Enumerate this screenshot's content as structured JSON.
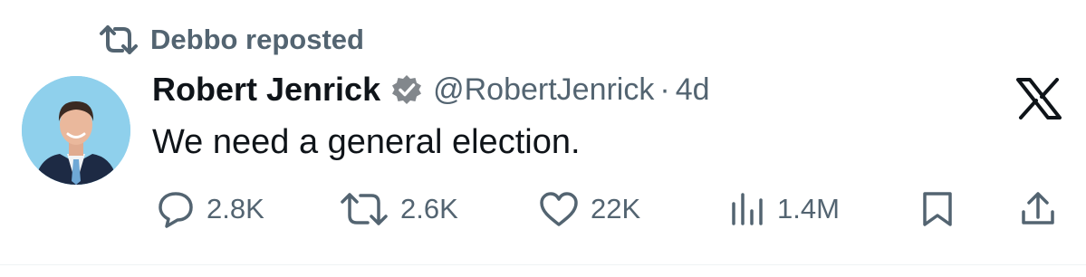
{
  "repost": {
    "label": "Debbo reposted",
    "icon": "repost-icon"
  },
  "author": {
    "name": "Robert Jenrick",
    "verified_icon": "verified-badge-icon",
    "handle": "@RobertJenrick",
    "separator": "·",
    "time": "4d"
  },
  "tweet": {
    "text": "We need a general election."
  },
  "actions": {
    "replies": "2.8K",
    "reposts": "2.6K",
    "likes": "22K",
    "views": "1.4M"
  },
  "colors": {
    "text": "#0f1419",
    "muted": "#536471",
    "verified": "#82878c"
  }
}
